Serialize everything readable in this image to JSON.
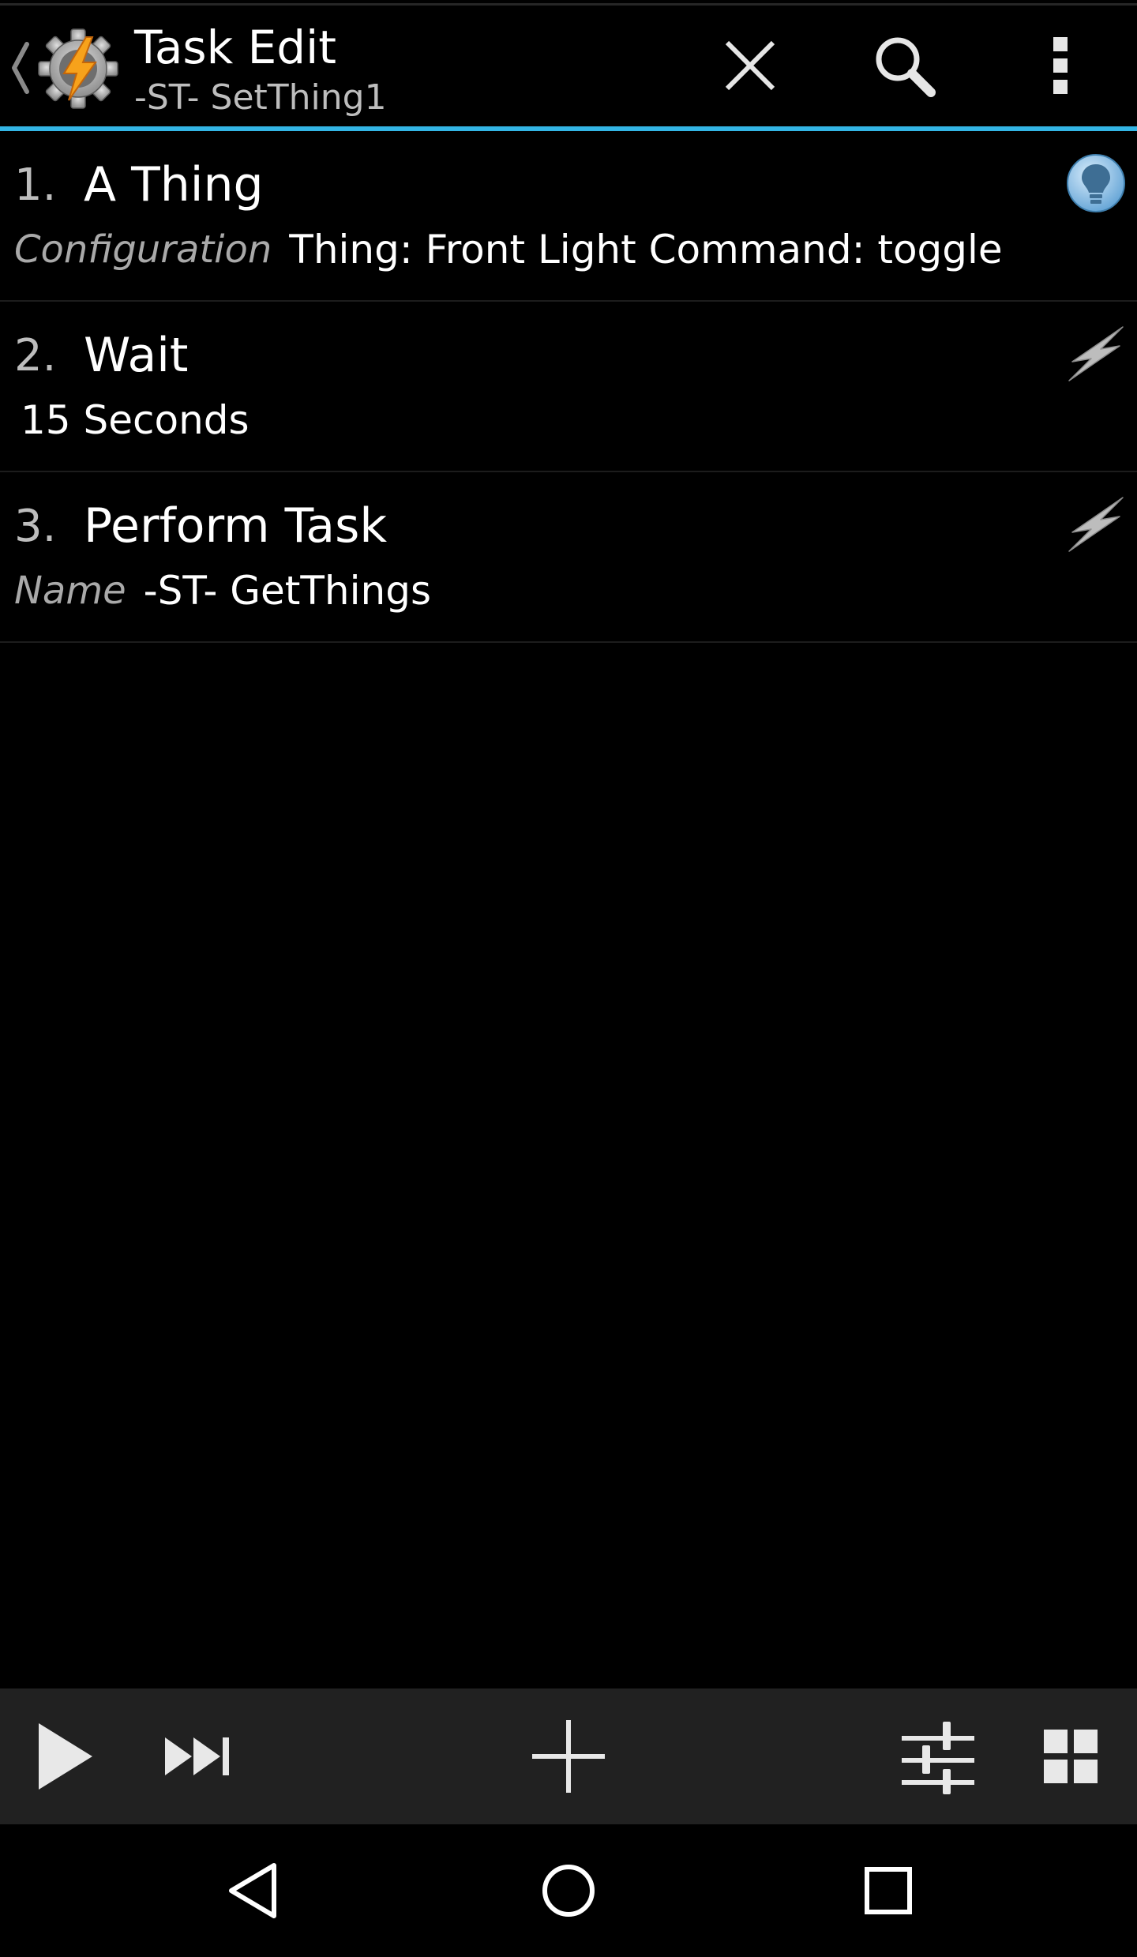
{
  "header": {
    "title": "Task Edit",
    "subtitle": "-ST- SetThing1",
    "accent_color": "#33b5e5",
    "icons": {
      "up": "chevron-left-icon",
      "app": "tasker-gear-bolt-icon",
      "close": "close-icon",
      "search": "search-icon",
      "overflow": "more-vertical-icon"
    }
  },
  "actions": [
    {
      "number": "1.",
      "name": "A Thing",
      "detail_key": "Configuration",
      "detail_value": "Thing: Front Light Command: toggle",
      "icon": "lightbulb-icon"
    },
    {
      "number": "2.",
      "name": "Wait",
      "detail_key": "",
      "detail_value": "15 Seconds",
      "icon": "lightning-icon"
    },
    {
      "number": "3.",
      "name": "Perform Task",
      "detail_key": "Name",
      "detail_value": "-ST- GetThings",
      "icon": "lightning-icon"
    }
  ],
  "toolbar": {
    "icons": [
      "play-icon",
      "step-forward-icon",
      "add-icon",
      "sliders-icon",
      "grid-icon"
    ],
    "background": "#212121"
  },
  "navbar": {
    "icons": [
      "back-triangle-icon",
      "home-circle-icon",
      "recents-square-icon"
    ]
  }
}
